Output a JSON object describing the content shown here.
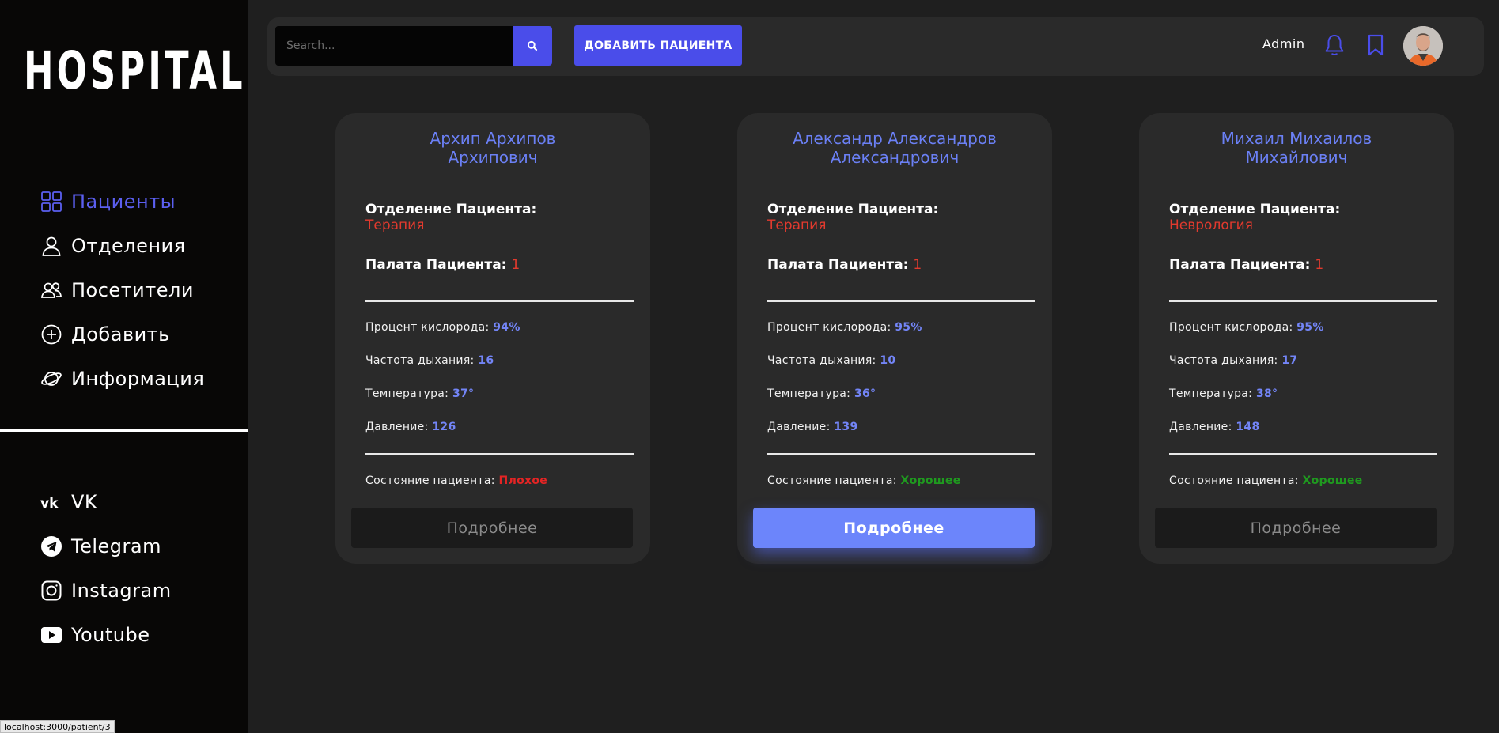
{
  "sidebar": {
    "logo": "HOSPITAL",
    "nav": [
      {
        "label": "Пациенты",
        "icon": "grid-icon",
        "active": true
      },
      {
        "label": "Отделения",
        "icon": "user-icon"
      },
      {
        "label": "Посетители",
        "icon": "users-icon"
      },
      {
        "label": "Добавить",
        "icon": "plus-circle-icon"
      },
      {
        "label": "Информация",
        "icon": "planet-icon"
      }
    ],
    "social": [
      {
        "label": "VK",
        "icon": "vk-icon"
      },
      {
        "label": "Telegram",
        "icon": "telegram-icon"
      },
      {
        "label": "Instagram",
        "icon": "instagram-icon"
      },
      {
        "label": "Youtube",
        "icon": "youtube-icon"
      }
    ]
  },
  "status_url": "localhost:3000/patient/3",
  "header": {
    "search_placeholder": "Search...",
    "add_patient_label": "ДОБАВИТЬ ПАЦИЕНТА",
    "user_name": "Admin"
  },
  "colors": {
    "accent": "#4a4dea",
    "name": "#6b80f5",
    "value": "#7385f7",
    "danger": "#e23a2e",
    "good": "#1f9a1f"
  },
  "labels": {
    "department": "Отделение Пациента:",
    "ward": "Палата Пациента:",
    "oxygen": "Процент кислорода:",
    "breathing": "Частота дыхания:",
    "temperature": "Температура:",
    "pressure": "Давление:",
    "condition": "Состояние пациента:",
    "more": "Подробнее"
  },
  "patients": [
    {
      "name_line1": "Архип Архипов",
      "name_line2": "Архипович",
      "department": "Терапия",
      "ward": "1",
      "oxygen": "94%",
      "breathing": "16",
      "temperature": "37°",
      "pressure": "126",
      "condition": "Плохое",
      "condition_state": "bad"
    },
    {
      "name_line1": "Александр Александров",
      "name_line2": "Александрович",
      "department": "Терапия",
      "ward": "1",
      "oxygen": "95%",
      "breathing": "10",
      "temperature": "36°",
      "pressure": "139",
      "condition": "Хорошее",
      "condition_state": "good"
    },
    {
      "name_line1": "Михаил Михаилов",
      "name_line2": "Михайлович",
      "department": "Неврология",
      "ward": "1",
      "oxygen": "95%",
      "breathing": "17",
      "temperature": "38°",
      "pressure": "148",
      "condition": "Хорошее",
      "condition_state": "good"
    }
  ]
}
